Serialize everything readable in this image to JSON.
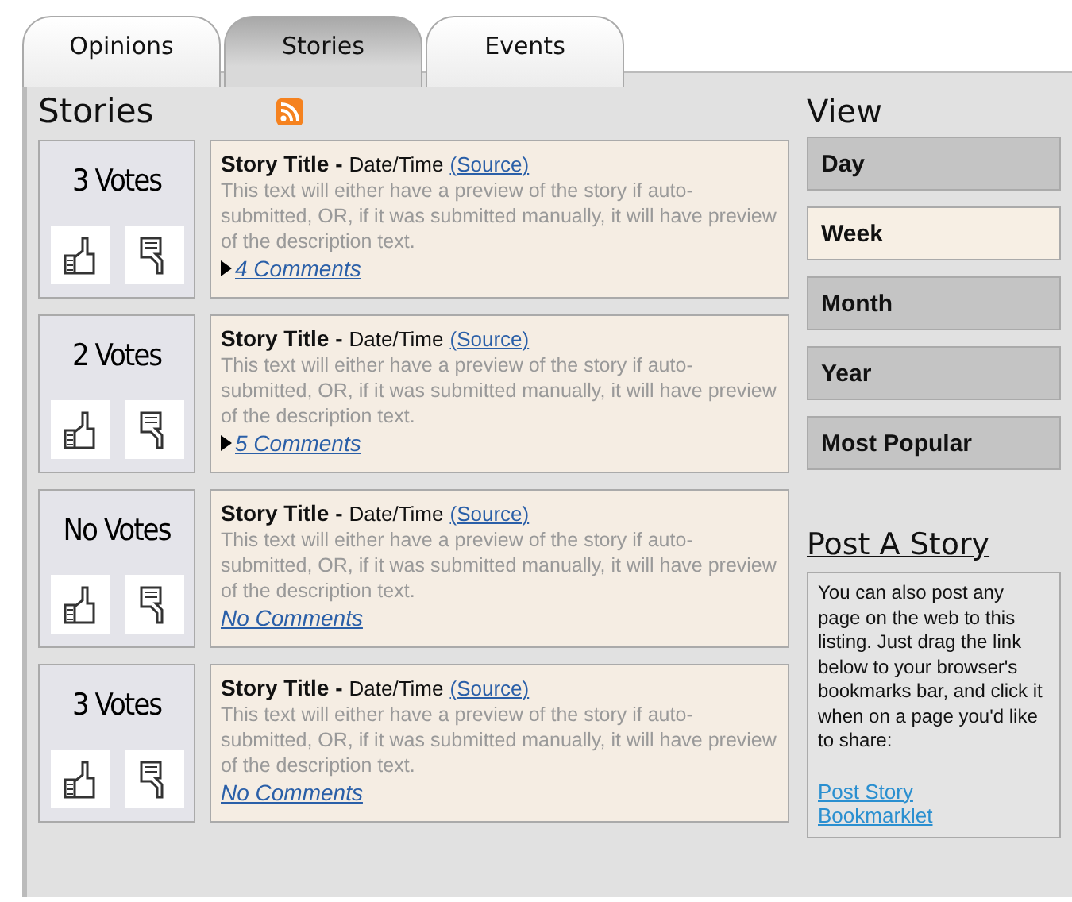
{
  "tabs": [
    {
      "label": "Opinions",
      "selected": false
    },
    {
      "label": "Stories",
      "selected": true
    },
    {
      "label": "Events",
      "selected": false
    }
  ],
  "stories_heading": "Stories",
  "stories": [
    {
      "votes": "3 Votes",
      "title": "Story Title -",
      "datetime": "Date/Time",
      "source": "(Source)",
      "preview": "This text will either have a preview of the story if auto-submitted, OR, if it was submitted manually, it will have preview of the description text.",
      "comments": "4 Comments",
      "expandable": true
    },
    {
      "votes": "2 Votes",
      "title": "Story Title -",
      "datetime": "Date/Time",
      "source": "(Source)",
      "preview": "This text will either have a preview of the story if auto-submitted, OR, if it was submitted manually, it will have preview of the description text.",
      "comments": "5 Comments",
      "expandable": true
    },
    {
      "votes": "No Votes",
      "title": "Story Title -",
      "datetime": "Date/Time",
      "source": "(Source)",
      "preview": "This text will either have a preview of the story if auto-submitted, OR, if it was submitted manually, it will have preview of the description text.",
      "comments": "No Comments",
      "expandable": false
    },
    {
      "votes": "3 Votes",
      "title": "Story Title -",
      "datetime": "Date/Time",
      "source": "(Source)",
      "preview": "This text will either have a preview of the story if auto-submitted, OR, if it was submitted manually, it will have preview of the description text.",
      "comments": "No Comments",
      "expandable": false
    }
  ],
  "view": {
    "heading": "View",
    "items": [
      {
        "label": "Day",
        "selected": false
      },
      {
        "label": "Week",
        "selected": true
      },
      {
        "label": "Month",
        "selected": false
      },
      {
        "label": "Year",
        "selected": false
      },
      {
        "label": "Most Popular",
        "selected": false
      }
    ]
  },
  "post": {
    "heading": "Post A Story",
    "text": "You can also post any page on the web to this listing. Just drag the link below to your browser's bookmarks bar, and click it when on a page you'd like to share:",
    "link": "Post Story Bookmarklet"
  }
}
